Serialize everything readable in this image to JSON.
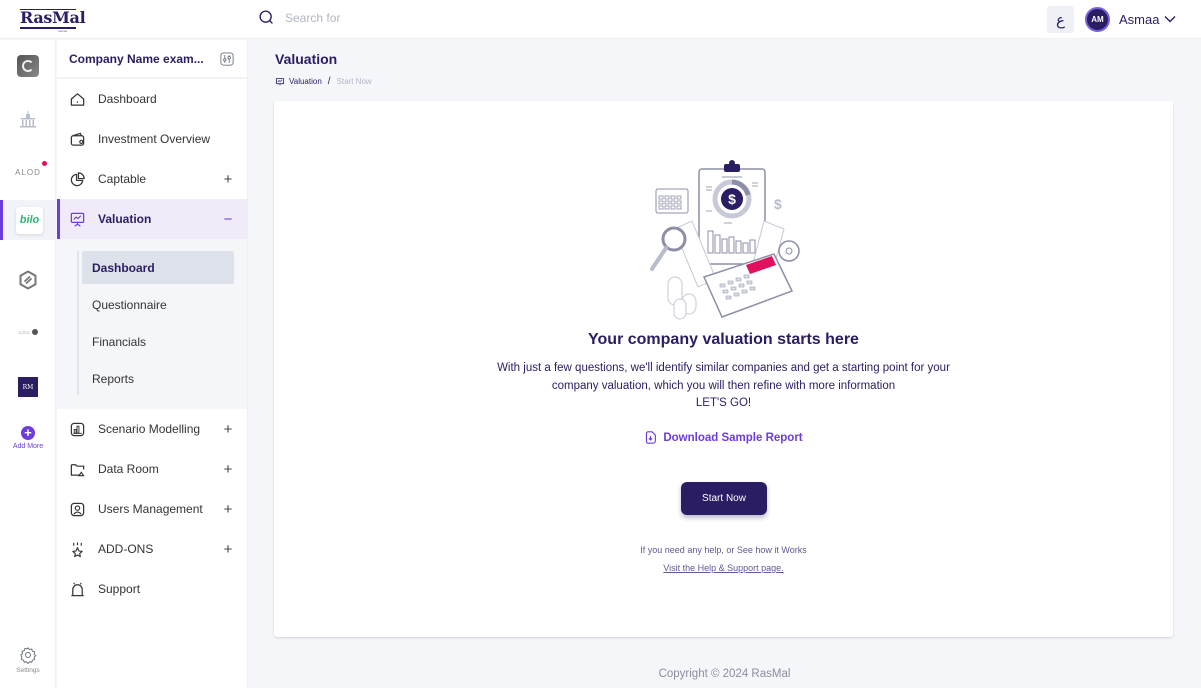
{
  "header": {
    "logo": "RasMal",
    "logo_tagline": "rasmal",
    "search_placeholder": "Search for",
    "language_toggle": "ع",
    "user_initials": "AM",
    "user_name": "Asmaa"
  },
  "rail": {
    "apps": [
      {
        "name": "app-1"
      },
      {
        "name": "app-2"
      },
      {
        "name": "ALOD",
        "label": "ALOD",
        "has_notification": true
      },
      {
        "name": "bilo",
        "label": "bilo",
        "active": true
      },
      {
        "name": "app-5"
      },
      {
        "name": "app-6"
      },
      {
        "name": "RM",
        "label": "RM"
      }
    ],
    "add_more_label": "Add More",
    "settings_label": "Settings"
  },
  "nav": {
    "company_name": "Company Name exam...",
    "items": [
      {
        "label": "Dashboard",
        "icon": "home-icon"
      },
      {
        "label": "Investment Overview",
        "icon": "wallet-icon"
      },
      {
        "label": "Captable",
        "icon": "pie-chart-icon",
        "toggle": "+"
      },
      {
        "label": "Valuation",
        "icon": "presentation-icon",
        "toggle": "−",
        "active": true
      },
      {
        "label": "Scenario Modelling",
        "icon": "bar-chart-icon",
        "toggle": "+"
      },
      {
        "label": "Data Room",
        "icon": "folder-icon",
        "toggle": "+"
      },
      {
        "label": "Users Management",
        "icon": "user-icon",
        "toggle": "+"
      },
      {
        "label": "ADD-ONS",
        "icon": "addons-icon",
        "toggle": "+"
      },
      {
        "label": "Support",
        "icon": "bell-icon"
      }
    ],
    "valuation_sub": [
      {
        "label": "Dashboard",
        "active": true
      },
      {
        "label": "Questionnaire"
      },
      {
        "label": "Financials"
      },
      {
        "label": "Reports"
      }
    ]
  },
  "main": {
    "title": "Valuation",
    "breadcrumb": {
      "parent": "Valuation",
      "separator": "/",
      "current": "Start Now"
    },
    "hero_title": "Your company valuation starts here",
    "hero_line1": "With just a few questions, we'll identify similar companies and get a starting point for your",
    "hero_line2": "company valuation, which you will then refine with more information",
    "hero_line3": "LET'S GO!",
    "download_label": "Download Sample Report",
    "start_button": "Start Now",
    "help_text": "If you need any help, or See how it Works",
    "help_link": "Visit the Help & Support page."
  },
  "footer": {
    "copyright": "Copyright © 2024 RasMal"
  },
  "colors": {
    "brand_dark": "#2a1d63",
    "accent": "#6c3ce0",
    "active_bg": "#f0eaf9",
    "page_bg": "#f5f6fa",
    "calculator_display": "#e0115f"
  }
}
